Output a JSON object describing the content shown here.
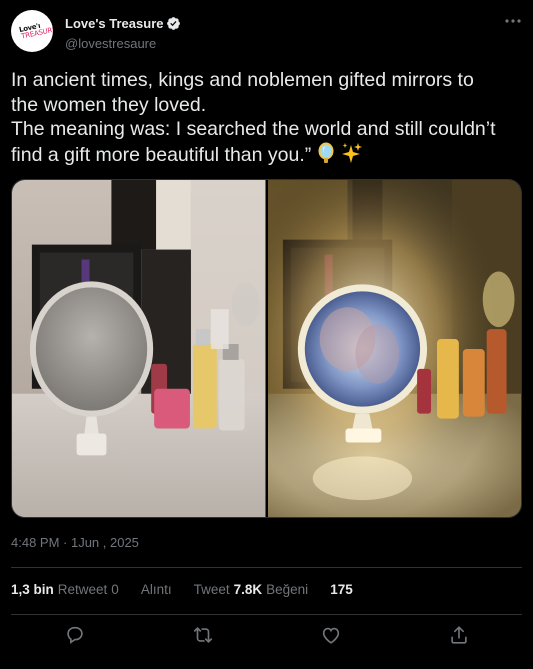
{
  "author": {
    "display_name": "Love's Treasure",
    "handle": "@lovestresaure",
    "avatar_text_line1": "Love'ı",
    "avatar_text_line2": "TREASURE",
    "verified_icon": "verified-badge-icon",
    "verified_color": "#e7e9ea"
  },
  "tweet": {
    "lines": [
      "In ancient times, kings and noblemen gifted mirrors to",
      "the women they loved.",
      "The meaning was: I searched the world and still couldn’t",
      "find a gift more beautiful than you.”"
    ],
    "emojis": [
      "mirror-emoji-icon",
      "sparkles-emoji-icon"
    ],
    "timestamp": "4:48 PM · 1Jun , 2025"
  },
  "media": [
    {
      "name": "mirror-off-photo",
      "description_icon": "photo"
    },
    {
      "name": "mirror-lit-photo",
      "description_icon": "photo"
    }
  ],
  "stats": {
    "retweets_value": "1,3 bin",
    "retweets_label": "Retweet",
    "quotes_value": "0",
    "quotes_label": "Alıntı",
    "likes_prefix_label": "Tweet",
    "likes_value": "7.8K",
    "likes_label": "Beğeni",
    "bookmarks_value": "175"
  },
  "actions": [
    "reply-icon",
    "retweet-icon",
    "like-icon",
    "share-icon"
  ],
  "colors": {
    "background": "#000000",
    "text": "#e7e9ea",
    "secondary": "#71767b",
    "divider": "#2f3336"
  }
}
